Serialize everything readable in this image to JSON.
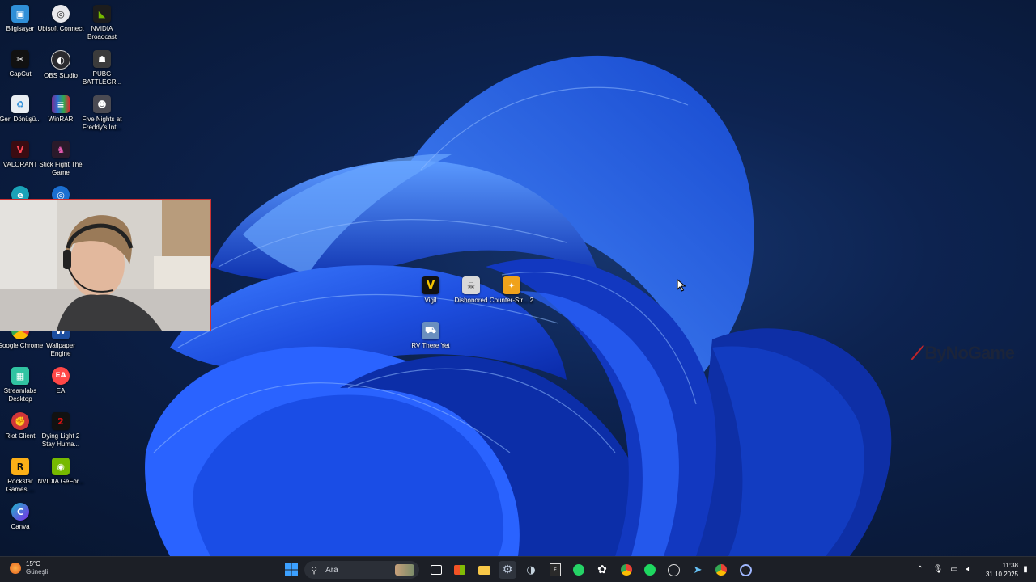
{
  "desktop_icons": [
    {
      "label": "Bilgisayar",
      "icon": "computer-icon",
      "color": "#2f8fd8"
    },
    {
      "label": "Ubisoft Connect",
      "icon": "ubisoft-icon",
      "color": "#e8e8ec"
    },
    {
      "label": "NVIDIA Broadcast",
      "icon": "nvidia-broadcast-icon",
      "color": "#1d1d1d"
    },
    {
      "label": "CapCut",
      "icon": "capcut-icon",
      "color": "#111111"
    },
    {
      "label": "OBS Studio",
      "icon": "obs-icon",
      "color": "#2a2a2e"
    },
    {
      "label": "PUBG BATTLEGR...",
      "icon": "pubg-icon",
      "color": "#3b3b3b"
    },
    {
      "label": "Geri Dönüşü...",
      "icon": "recycle-bin-icon",
      "color": "#e9eef3"
    },
    {
      "label": "WinRAR",
      "icon": "winrar-icon",
      "color": "#7a2d8c"
    },
    {
      "label": "Five Nights at Freddy's Int...",
      "icon": "fnaf-icon",
      "color": "#4a4a52"
    },
    {
      "label": "VALORANT",
      "icon": "valorant-icon",
      "color": "#ff4655"
    },
    {
      "label": "Stick Fight The Game",
      "icon": "stick-fight-icon",
      "color": "#2a1a2a"
    },
    {
      "label": "Google Chrome",
      "icon": "chrome-icon",
      "color": "#e94235"
    },
    {
      "label": "Wallpaper Engine",
      "icon": "wallpaper-engine-icon",
      "color": "#1b4ea0"
    },
    {
      "label": "Streamlabs Desktop",
      "icon": "streamlabs-icon",
      "color": "#31c3a2"
    },
    {
      "label": "EA",
      "icon": "ea-icon",
      "color": "#ff4747"
    },
    {
      "label": "Riot Client",
      "icon": "riot-icon",
      "color": "#d13639"
    },
    {
      "label": "Dying Light 2 Stay Huma...",
      "icon": "dying-light-icon",
      "color": "#121212"
    },
    {
      "label": "Rockstar Games ...",
      "icon": "rockstar-icon",
      "color": "#fcaf17"
    },
    {
      "label": "NVIDIA GeFor...",
      "icon": "geforce-icon",
      "color": "#76b900"
    },
    {
      "label": "Canva",
      "icon": "canva-icon",
      "color": "#1fb6c9"
    },
    {
      "label": "Vigil",
      "icon": "vigil-icon",
      "color": "#111111"
    },
    {
      "label": "Dishonored",
      "icon": "dishonored-icon",
      "color": "#2a2a2a"
    },
    {
      "label": "Counter-Str... 2",
      "icon": "cs2-icon",
      "color": "#f0a21b"
    },
    {
      "label": "RV There Yet",
      "icon": "rv-there-yet-icon",
      "color": "#6a8fbf"
    }
  ],
  "watermark": "ByNoGame",
  "taskbar": {
    "weather": {
      "temp": "15°C",
      "condition": "Güneşli"
    },
    "search_placeholder": "Ara",
    "clock": {
      "time": "11:38",
      "date": "31.10.2025"
    },
    "apps": [
      "start-icon",
      "task-view-icon",
      "microsoft-store-icon",
      "file-explorer-icon",
      "settings-icon",
      "steam-icon",
      "epic-games-icon",
      "whatsapp-icon",
      "chatgpt-icon",
      "chrome-icon",
      "spotify-icon",
      "obs-icon",
      "steam-icon",
      "chrome-icon",
      "cortana-icon"
    ]
  },
  "colors": {
    "taskbar_bg": "#1c1f26",
    "accent": "#0a5bd6"
  }
}
